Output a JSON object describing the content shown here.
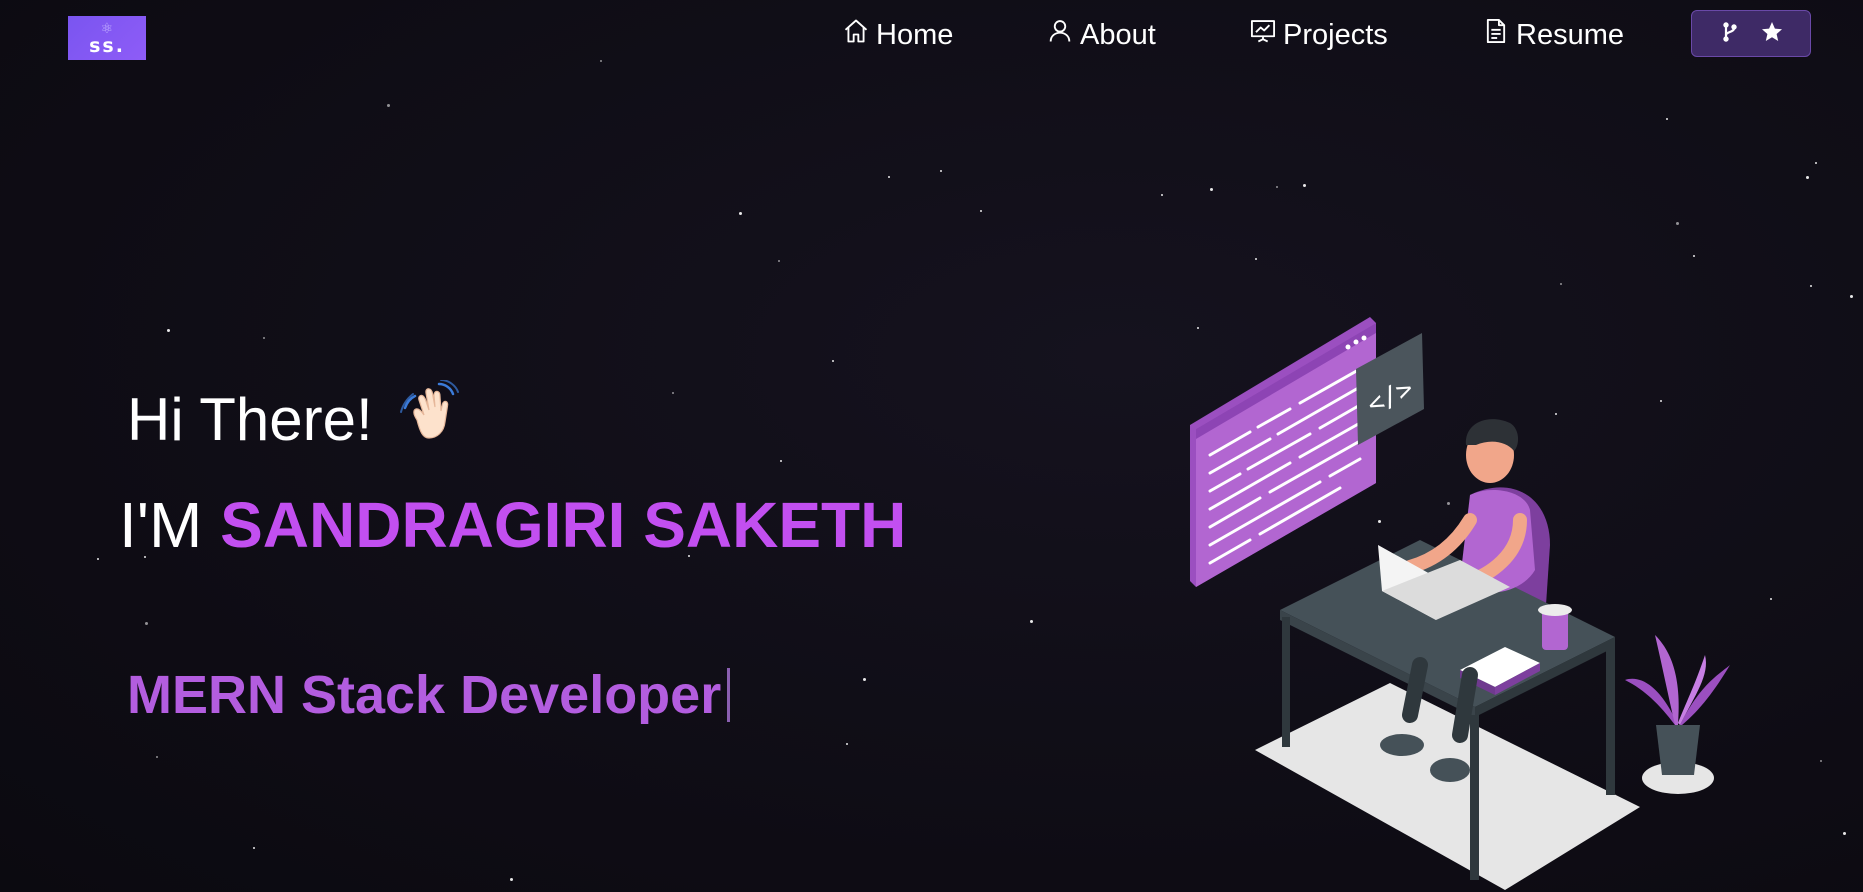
{
  "nav": {
    "logo_text": "ss.",
    "items": [
      {
        "label": "Home",
        "icon": "home-icon"
      },
      {
        "label": "About",
        "icon": "user-icon"
      },
      {
        "label": "Projects",
        "icon": "presentation-icon"
      },
      {
        "label": "Resume",
        "icon": "document-icon"
      }
    ],
    "github_button": {
      "icons": [
        "git-fork-icon",
        "star-icon"
      ]
    }
  },
  "hero": {
    "greeting": "Hi There!",
    "greeting_emoji": "waving-hand",
    "intro_prefix": "I'M",
    "name": "SANDRAGIRI SAKETH",
    "role": "MERN Stack Developer"
  },
  "colors": {
    "background": "#0f0d15",
    "accent": "#c24ff0",
    "role_text": "#b35ddf",
    "logo": "#7a55f0",
    "github_button": "#3e2a66"
  }
}
